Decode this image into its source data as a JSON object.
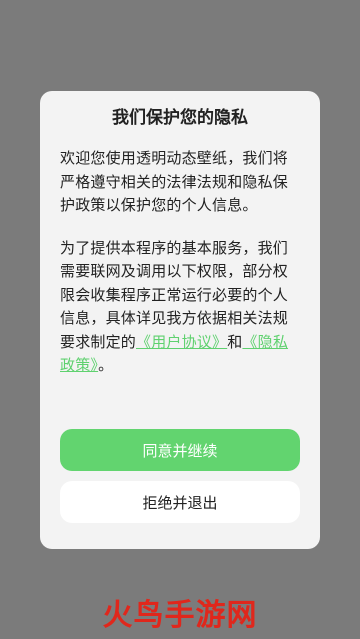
{
  "dialog": {
    "title": "我们保护您的隐私",
    "paragraph1": "欢迎您使用透明动态壁纸，我们将严格遵守相关的法律法规和隐私保护政策以保护您的个人信息。",
    "paragraph2_main": "为了提供本程序的基本服务，我们需要联网及调用以下权限，部分权限会收集程序正常运行必要的个人信息，具体详见我方依据相关法规要求制定的",
    "link_user_agreement": "《用户协议》",
    "and_text": "和",
    "link_privacy_policy": "《隐私政策》",
    "end_period": "。",
    "agree_label": "同意并继续",
    "reject_label": "拒绝并退出"
  },
  "watermark": "火鸟手游网",
  "colors": {
    "overlay": "#7b7b7b",
    "dialog_bg": "#f3f3f3",
    "accent": "#62d46f",
    "link": "#5fd16f",
    "watermark": "#e0271c"
  }
}
